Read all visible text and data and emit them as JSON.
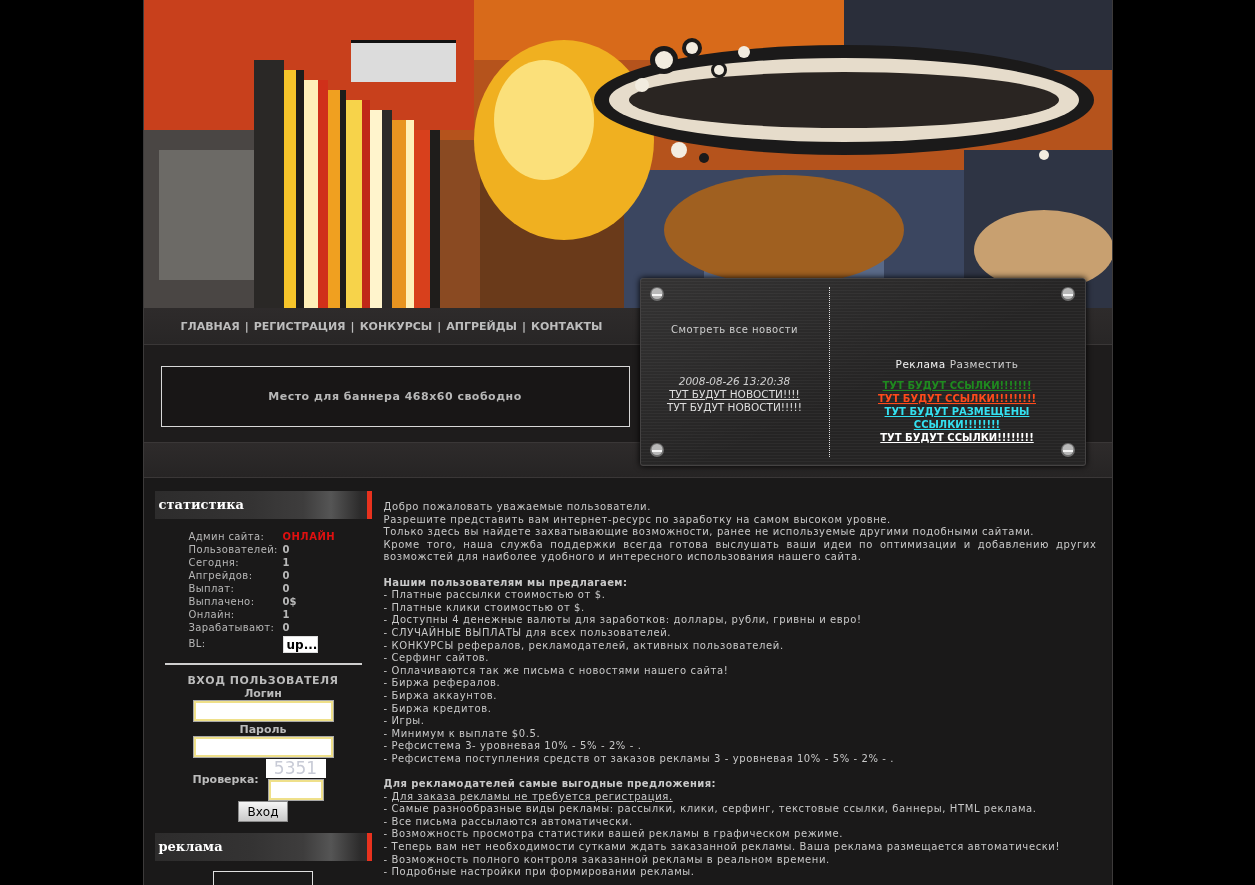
{
  "nav": {
    "items": [
      "ГЛАВНАЯ",
      "РЕГИСТРАЦИЯ",
      "КОНКУРСЫ",
      "АПГРЕЙДЫ",
      "КОНТАКТЫ"
    ],
    "separators": [
      "|",
      "|",
      "|",
      "|"
    ]
  },
  "banner": {
    "text": "Место для баннера 468x60 свободно"
  },
  "news_panel": {
    "all_news_link": "Смотреть все новости",
    "date": "2008-08-26 13:20:38",
    "items": [
      {
        "kind": "link",
        "text": "ТУТ БУДУТ НОВОСТИ!!!!"
      },
      {
        "kind": "text",
        "text": "ТУТ БУДУТ НОВОСТИ!!!!!"
      }
    ],
    "ads_title": "Реклама",
    "place_ad_link": "Разместить",
    "ad_links": [
      {
        "text": "ТУТ БУДУТ ССЫЛКИ!!!!!!!",
        "color": "#1f8a1f"
      },
      {
        "text": "ТУТ БУДУТ ССЫЛКИ!!!!!!!!!",
        "color": "#ff4a1a"
      },
      {
        "text": "ТУТ БУДУТ РАЗМЕЩЕНЫ ССЫЛКИ!!!!!!!!",
        "color": "#33e0f0"
      },
      {
        "text": "ТУТ БУДУТ ССЫЛКИ!!!!!!!!",
        "color": "#ffffff"
      }
    ]
  },
  "sidebar": {
    "stats": {
      "title": "статистика",
      "rows": [
        {
          "label": "Админ сайта:",
          "value": "ОНЛАЙН",
          "kind": "status"
        },
        {
          "label": "Пользователей:",
          "value": "0",
          "kind": "number"
        },
        {
          "label": "Сегодня:",
          "value": "1",
          "kind": "number"
        },
        {
          "label": "Апгрейдов:",
          "value": "0",
          "kind": "number"
        },
        {
          "label": "Выплат:",
          "value": "0",
          "kind": "number"
        },
        {
          "label": "Выплачено:",
          "value": "0$",
          "kind": "number"
        },
        {
          "label": "Онлайн:",
          "value": "1",
          "kind": "number"
        },
        {
          "label": "Зарабатывают:",
          "value": "0",
          "kind": "number"
        },
        {
          "label": "BL:",
          "value": "up...",
          "kind": "button"
        }
      ]
    },
    "login": {
      "title": "ВХОД ПОЛЬЗОВАТЕЛЯ",
      "login_label": "Логин",
      "password_label": "Пароль",
      "captcha_label": "Проверка:",
      "captcha_code": "5351",
      "submit": "Вход"
    },
    "ads": {
      "title": "реклама"
    }
  },
  "content": {
    "intro": [
      "Добро пожаловать уважаемые пользователи.",
      "Разрешите представить вам интернет-ресурс по заработку на самом высоком уровне.",
      "Только здесь вы найдете захватывающие возможности, ранее не используемые другими подобными сайтами.",
      "Кроме того, наша служба поддержки всегда готова выслушать ваши идеи по оптимизации и добавлению других возможстей для наиболее удобного и интересного использования нашего сайта."
    ],
    "sections": [
      {
        "heading": "Нашим пользователям мы предлагаем:",
        "items": [
          {
            "kind": "text",
            "text": "- Платные рассылки стоимостью от $."
          },
          {
            "kind": "text",
            "text": "- Платные клики стоимостью от $."
          },
          {
            "kind": "text",
            "text": "- Доступны 4 денежные валюты для заработков: доллары, рубли, гривны и евро!"
          },
          {
            "kind": "text",
            "text": "- СЛУЧАЙНЫЕ ВЫПЛАТЫ для всех пользователей."
          },
          {
            "kind": "text",
            "text": "- КОНКУРСЫ рефералов, рекламодателей, активных пользователей."
          },
          {
            "kind": "text",
            "text": "- Серфинг сайтов."
          },
          {
            "kind": "text",
            "text": "- Оплачиваются так же письма с новостями нашего сайта!"
          },
          {
            "kind": "text",
            "text": "- Биржа рефералов."
          },
          {
            "kind": "text",
            "text": "- Биржа аккаунтов."
          },
          {
            "kind": "text",
            "text": "- Биржа кредитов."
          },
          {
            "kind": "text",
            "text": "- Игры."
          },
          {
            "kind": "text",
            "text": "- Минимум к выплате $0.5."
          },
          {
            "kind": "text",
            "text": "- Рефсистема 3- уровневая 10% - 5% - 2% - ."
          },
          {
            "kind": "text",
            "text": "- Рефсистема поступления средств от заказов рекламы 3 - уровневая 10% - 5% - 2% - ."
          }
        ]
      },
      {
        "heading": "Для рекламодателей самые выгодные предложения:",
        "items": [
          {
            "kind": "link",
            "prefix": "-",
            "text": "Для заказа рекламы не требуется регистрация."
          },
          {
            "kind": "text",
            "text": "- Самые разнообразные виды рекламы: рассылки, клики, серфинг, текстовые ссылки, баннеры, HTML реклама."
          },
          {
            "kind": "text",
            "text": "- Все письма рассылаются автоматически."
          },
          {
            "kind": "text",
            "text": "- Возможность просмотра статистики вашей рекламы в графическом режиме."
          },
          {
            "kind": "text",
            "text": "- Теперь вам нет необходимости сутками ждать заказанной рекламы. Ваша реклама размещается автоматически!"
          },
          {
            "kind": "text",
            "text": "- Возможность полного контроля заказанной рекламы в реальном времени."
          },
          {
            "kind": "text",
            "text": "- Подробные настройки при формировании рекламы."
          }
        ]
      }
    ]
  }
}
